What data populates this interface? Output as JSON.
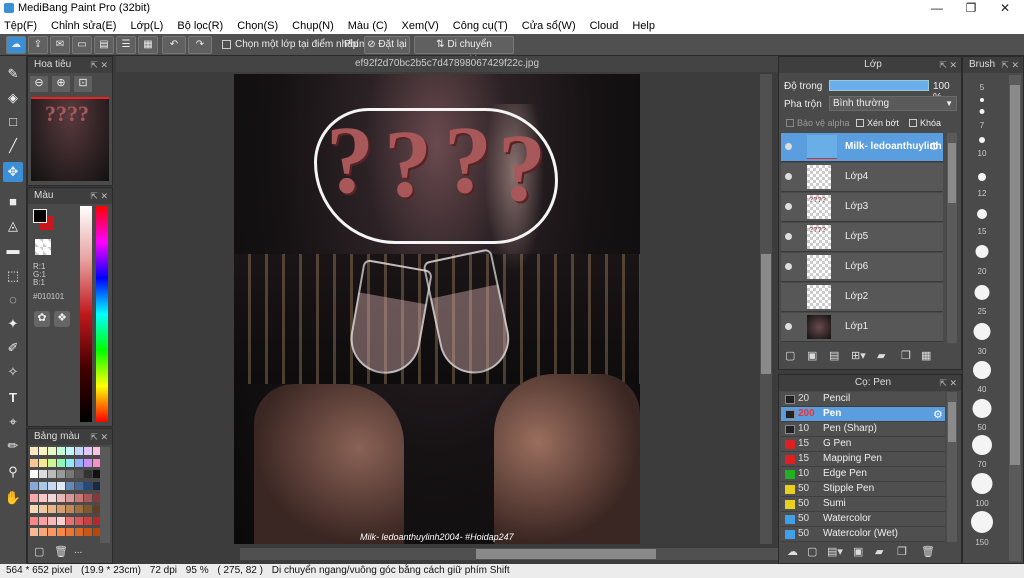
{
  "title": "MediBang Paint Pro (32bit)",
  "menu": [
    "Tệp(F)",
    "Chỉnh sửa(E)",
    "Lớp(L)",
    "Bộ lọc(R)",
    "Chọn(S)",
    "Chụp(N)",
    "Màu (C)",
    "Xem(V)",
    "Công cụ(T)",
    "Cửa sổ(W)",
    "Cloud",
    "Help"
  ],
  "toolbar": {
    "snap_checkbox_label": "Chọn một lớp tại điểm nhấp",
    "pen_label": "Phím",
    "reset_label": "Đặt lại",
    "move_label": "Di chuyển ngang/dọc"
  },
  "navigator": {
    "title": "Hoa tiêu"
  },
  "color": {
    "title": "Màu",
    "r": "R:1",
    "g": "G:1",
    "b": "B:1",
    "hex": "#010101",
    "fg": "#010101",
    "bg": "#c8181c"
  },
  "swatches": {
    "title": "Bảng màu",
    "more": "..."
  },
  "document": {
    "tab": "ef92f2d70bc2b5c7d47898067429f22c.jpg",
    "watermark": "Milk- ledoanthuylinh2004- #Hoidap247"
  },
  "layers": {
    "title": "Lớp",
    "opacity_label": "Độ trong",
    "opacity_value": "100 %",
    "blend_label": "Pha trộn",
    "blend_value": "Bình thường",
    "protect_alpha": "Bảo vệ alpha",
    "clipping": "Xén bớt",
    "lock": "Khóa",
    "items": [
      {
        "name": "Milk- ledoanthuylinh",
        "selected": true
      },
      {
        "name": "Lớp4"
      },
      {
        "name": "Lớp3"
      },
      {
        "name": "Lớp5"
      },
      {
        "name": "Lớp6"
      },
      {
        "name": "Lớp2"
      },
      {
        "name": "Lớp1"
      }
    ]
  },
  "brush_panel": {
    "title": "Cọ: Pen",
    "items": [
      {
        "size": "20",
        "name": "Pencil",
        "color": "#222222"
      },
      {
        "size": "200",
        "name": "Pen",
        "color": "#222222",
        "selected": true
      },
      {
        "size": "10",
        "name": "Pen (Sharp)",
        "color": "#222222"
      },
      {
        "size": "15",
        "name": "G Pen",
        "color": "#e02020"
      },
      {
        "size": "15",
        "name": "Mapping Pen",
        "color": "#e02020"
      },
      {
        "size": "10",
        "name": "Edge Pen",
        "color": "#20b020"
      },
      {
        "size": "50",
        "name": "Stipple Pen",
        "color": "#e8d020"
      },
      {
        "size": "50",
        "name": "Sumi",
        "color": "#e8d020"
      },
      {
        "size": "50",
        "name": "Watercolor",
        "color": "#40a0e8"
      },
      {
        "size": "50",
        "name": "Watercolor (Wet)",
        "color": "#40a0e8"
      }
    ]
  },
  "brush_sizes": {
    "title": "Brush",
    "items": [
      "5",
      "7",
      "10",
      "12",
      "15",
      "20",
      "25",
      "30",
      "40",
      "50",
      "70",
      "100",
      "150"
    ]
  },
  "status": {
    "size": "564 * 652 pixel",
    "physical": "(19.9 * 23cm)",
    "dpi": "72 dpi",
    "zoom": "95 %",
    "coords": "( 275, 82 )",
    "hint": "Di chuyển ngang/vuông góc bằng cách giữ phím Shift"
  }
}
